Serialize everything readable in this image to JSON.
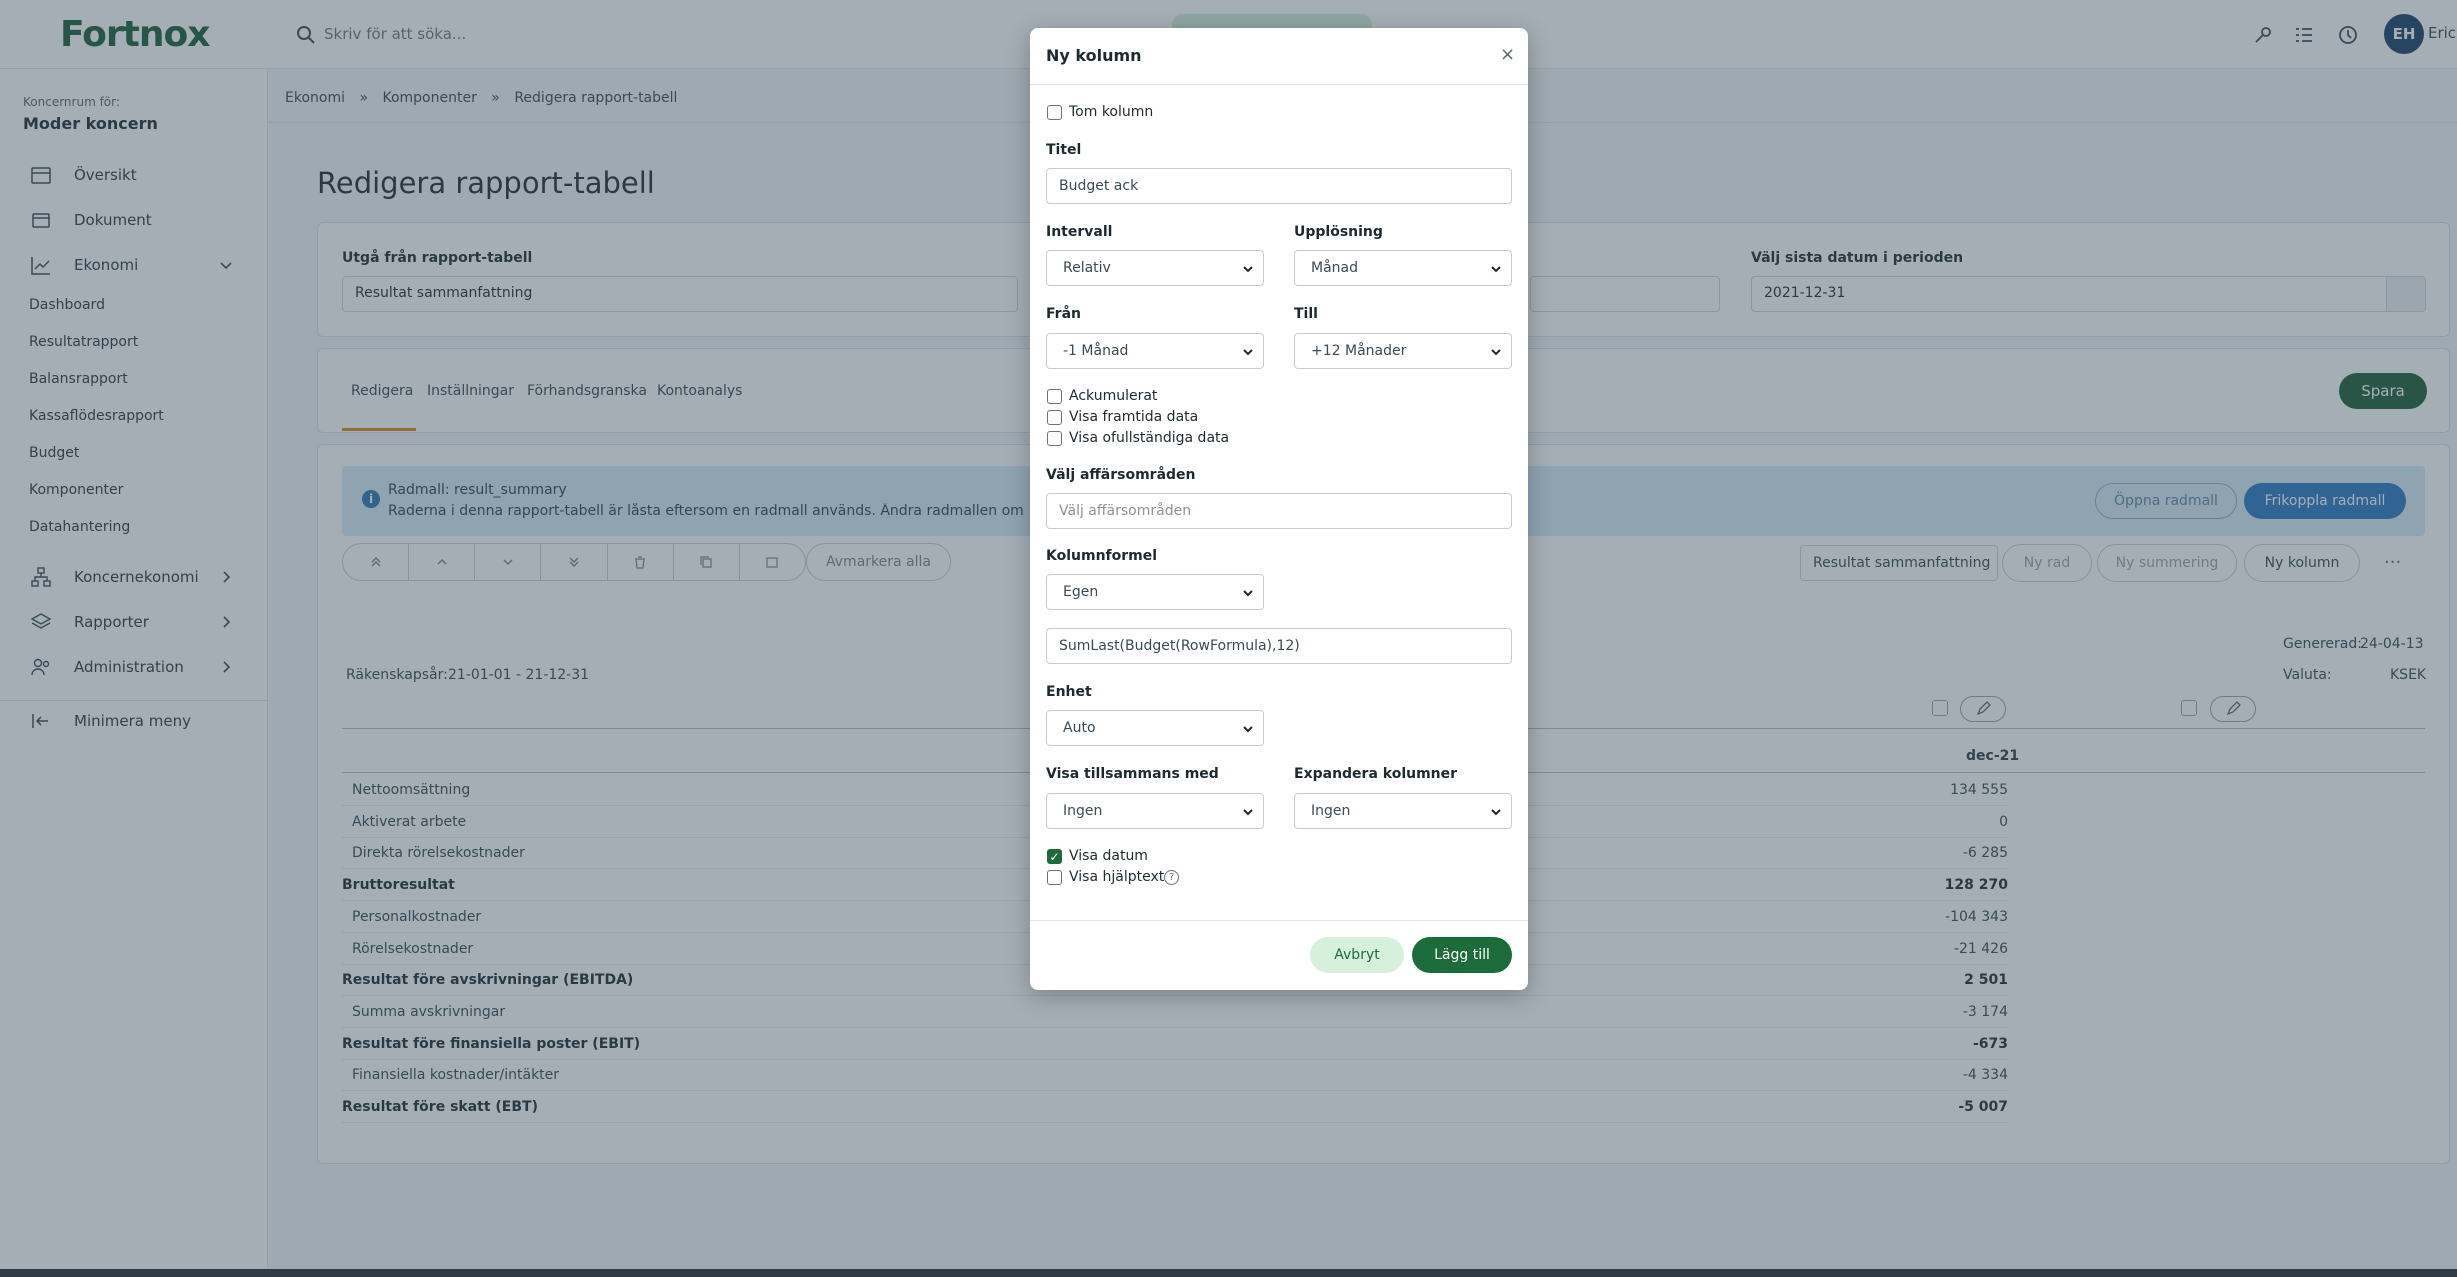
{
  "app": {
    "logo": "Fortnox"
  },
  "topbar": {
    "search_placeholder": "Skriv för att söka...",
    "user_initials": "EH",
    "user_name": "Eric"
  },
  "sidebar": {
    "koncern_label": "Koncernrum för:",
    "koncern_name": "Moder koncern",
    "items": [
      {
        "label": "Översikt",
        "icon": "calendar-icon"
      },
      {
        "label": "Dokument",
        "icon": "document-icon"
      },
      {
        "label": "Ekonomi",
        "icon": "chart-line-icon"
      }
    ],
    "sub_items": [
      "Dashboard",
      "Resultatrapport",
      "Balansrapport",
      "Kassaflödesrapport",
      "Budget",
      "Komponenter",
      "Datahantering"
    ],
    "groups": [
      {
        "label": "Koncernekonomi",
        "icon": "hierarchy-icon"
      },
      {
        "label": "Rapporter",
        "icon": "layers-icon"
      },
      {
        "label": "Administration",
        "icon": "users-icon"
      }
    ],
    "minimize": "Minimera meny"
  },
  "breadcrumb": [
    "Ekonomi",
    "»",
    "Komponenter",
    "»",
    "Redigera rapport-tabell"
  ],
  "page": {
    "title": "Redigera rapport-tabell",
    "utga_label": "Utgå från rapport-tabell",
    "utga_value": "Resultat sammanfattning",
    "sista_label": "Välj sista datum i perioden",
    "sista_value": "2021-12-31"
  },
  "tabs": [
    "Redigera",
    "Inställningar",
    "Förhandsgranska",
    "Kontoanalys"
  ],
  "spara": "Spara",
  "info": {
    "title": "Radmall: result_summary",
    "text": "Raderna i denna rapport-tabell är låsta eftersom en radmall används. Ändra radmallen om du önskar",
    "oppna": "Öppna radmall",
    "frikoppla": "Frikoppla radmall"
  },
  "toolbar": {
    "avmarkera": "Avmarkera alla",
    "resultat_select": "Resultat sammanfattning",
    "ny_rad": "Ny rad",
    "ny_summering": "Ny summering",
    "ny_kolumn": "Ny kolumn",
    "more": "···"
  },
  "report": {
    "genererad_label": "Genererad:",
    "genererad_value": "24-04-13",
    "valuta_label": "Valuta:",
    "valuta_value": "KSEK",
    "rakenskap_label": "Räkenskapsår:",
    "rakenskap_value": "21-01-01 - 21-12-31",
    "column_header": "dec-21",
    "rows": [
      {
        "label": "Nettoomsättning",
        "value": "134 555",
        "bold": false
      },
      {
        "label": "Aktiverat arbete",
        "value": "0",
        "bold": false
      },
      {
        "label": "Direkta rörelsekostnader",
        "value": "-6 285",
        "bold": false
      },
      {
        "label": "Bruttoresultat",
        "value": "128 270",
        "bold": true
      },
      {
        "label": "Personalkostnader",
        "value": "-104 343",
        "bold": false
      },
      {
        "label": "Rörelsekostnader",
        "value": "-21 426",
        "bold": false
      },
      {
        "label": "Resultat före avskrivningar (EBITDA)",
        "value": "2 501",
        "bold": true
      },
      {
        "label": "Summa avskrivningar",
        "value": "-3 174",
        "bold": false
      },
      {
        "label": "Resultat före finansiella poster (EBIT)",
        "value": "-673",
        "bold": true
      },
      {
        "label": "Finansiella kostnader/intäkter",
        "value": "-4 334",
        "bold": false
      },
      {
        "label": "Resultat före skatt (EBT)",
        "value": "-5 007",
        "bold": true
      }
    ]
  },
  "modal": {
    "title": "Ny kolumn",
    "close": "×",
    "tom_kolumn": "Tom kolumn",
    "titel_label": "Titel",
    "titel_value": "Budget ack",
    "intervall_label": "Intervall",
    "intervall_value": "Relativ",
    "upplosning_label": "Upplösning",
    "upplosning_value": "Månad",
    "fran_label": "Från",
    "fran_value": "-1 Månad",
    "till_label": "Till",
    "till_value": "+12 Månader",
    "ackumulerat": "Ackumulerat",
    "visa_framtida": "Visa framtida data",
    "visa_ofullstandiga": "Visa ofullständiga data",
    "affars_label": "Välj affärsområden",
    "affars_placeholder": "Välj affärsområden",
    "kolumnformel_label": "Kolumnformel",
    "kolumnformel_value": "Egen",
    "formula_value": "SumLast(Budget(RowFormula),12)",
    "enhet_label": "Enhet",
    "enhet_value": "Auto",
    "visa_tillsammans_label": "Visa tillsammans med",
    "visa_tillsammans_value": "Ingen",
    "expandera_label": "Expandera kolumner",
    "expandera_value": "Ingen",
    "visa_datum": "Visa datum",
    "visa_hjalptext": "Visa hjälptext",
    "avbryt": "Avbryt",
    "lagg_till": "Lägg till"
  }
}
